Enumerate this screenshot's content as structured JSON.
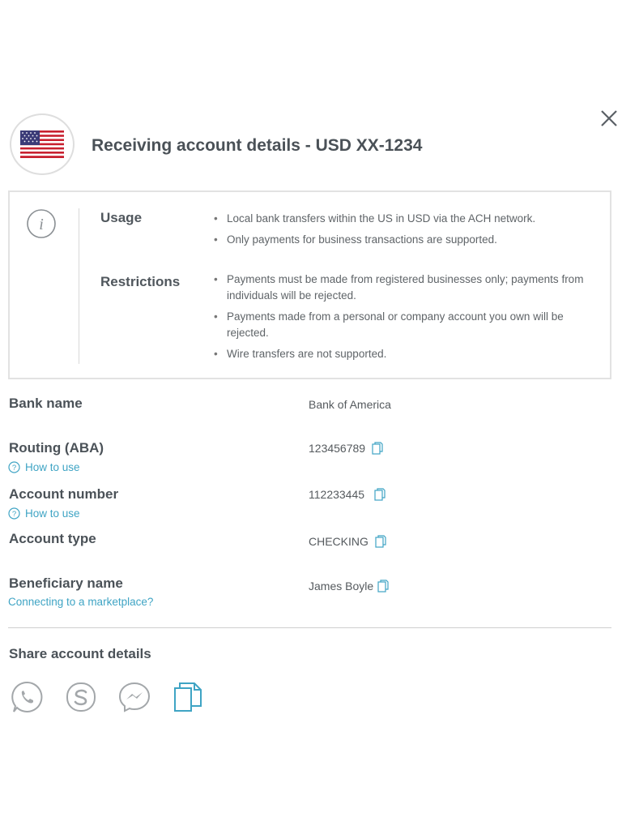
{
  "header": {
    "title": "Receiving account details - USD XX-1234"
  },
  "info": {
    "usage_label": "Usage",
    "usage_items": [
      "Local bank transfers within the US in USD via the ACH network.",
      "Only payments for business transactions are supported."
    ],
    "restrictions_label": "Restrictions",
    "restrictions_items": [
      "Payments must be made from registered businesses only; payments from individuals will be rejected.",
      "Payments made from a personal or company account you own will be rejected.",
      "Wire transfers are not supported."
    ]
  },
  "fields": {
    "bank_name": {
      "label": "Bank name",
      "value": "Bank of America"
    },
    "routing": {
      "label": "Routing (ABA)",
      "value": "123456789",
      "help": "How to use"
    },
    "account_number": {
      "label": "Account number",
      "value": "112233445",
      "help": "How to use"
    },
    "account_type": {
      "label": "Account type",
      "value": "CHECKING"
    },
    "beneficiary": {
      "label": "Beneficiary name",
      "value": "James Boyle",
      "help": "Connecting to a marketplace?"
    }
  },
  "share": {
    "title": "Share account details",
    "icons": [
      "whatsapp-icon",
      "skype-icon",
      "messenger-icon",
      "copy-icon"
    ]
  },
  "colors": {
    "accent": "#3fa4c4",
    "text": "#4b5258",
    "border": "#e2e2e2"
  }
}
